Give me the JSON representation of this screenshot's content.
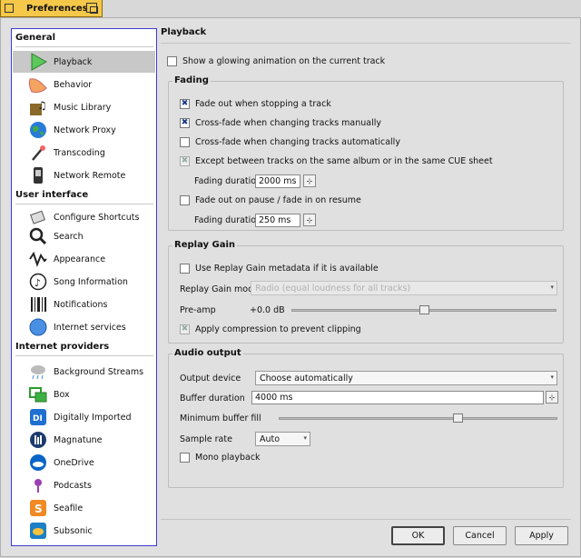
{
  "window": {
    "title": "Preferences"
  },
  "sidebar": {
    "sections": [
      {
        "heading": "General",
        "items": [
          {
            "label": "Playback",
            "icon": "play-icon"
          },
          {
            "label": "Behavior",
            "icon": "behavior-icon"
          },
          {
            "label": "Music Library",
            "icon": "music-library-icon"
          },
          {
            "label": "Network Proxy",
            "icon": "globe-icon"
          },
          {
            "label": "Transcoding",
            "icon": "magic-wand-icon"
          },
          {
            "label": "Network Remote",
            "icon": "remote-icon"
          }
        ]
      },
      {
        "heading": "User interface",
        "items": [
          {
            "label": "Configure Shortcuts",
            "icon": "shortcuts-icon"
          },
          {
            "label": "Search",
            "icon": "search-icon"
          },
          {
            "label": "Appearance",
            "icon": "appearance-icon"
          },
          {
            "label": "Song Information",
            "icon": "song-info-icon"
          },
          {
            "label": "Notifications",
            "icon": "notifications-icon"
          },
          {
            "label": "Internet services",
            "icon": "internet-icon"
          }
        ]
      },
      {
        "heading": "Internet providers",
        "items": [
          {
            "label": "Background Streams",
            "icon": "cloud-rain-icon"
          },
          {
            "label": "Box",
            "icon": "box-icon"
          },
          {
            "label": "Digitally Imported",
            "icon": "di-icon"
          },
          {
            "label": "Magnatune",
            "icon": "magnatune-icon"
          },
          {
            "label": "OneDrive",
            "icon": "onedrive-icon"
          },
          {
            "label": "Podcasts",
            "icon": "podcast-icon"
          },
          {
            "label": "Seafile",
            "icon": "seafile-icon"
          },
          {
            "label": "Subsonic",
            "icon": "subsonic-icon"
          }
        ]
      }
    ]
  },
  "playback": {
    "title": "Playback",
    "glow_label": "Show a glowing animation on the current track",
    "fading": {
      "title": "Fading",
      "fade_stop": "Fade out when stopping a track",
      "crossfade_manual": "Cross-fade when changing tracks manually",
      "crossfade_auto": "Cross-fade when changing tracks automatically",
      "except_album": "Except between tracks on the same album or in the same CUE sheet",
      "fading_duration_label": "Fading duration",
      "fading_duration_value": "2000 ms",
      "fade_pause": "Fade out on pause / fade in on resume",
      "fading_duration2_label": "Fading duration",
      "fading_duration2_value": "250 ms"
    },
    "replay_gain": {
      "title": "Replay Gain",
      "use_label": "Use Replay Gain metadata if it is available",
      "mode_label": "Replay Gain mode",
      "mode_value": "Radio (equal loudness for all tracks)",
      "preamp_label": "Pre-amp",
      "preamp_value": "+0.0 dB",
      "preamp_level": 0.5,
      "compress_label": "Apply compression to prevent clipping"
    },
    "audio_output": {
      "title": "Audio output",
      "device_label": "Output device",
      "device_value": "Choose automatically",
      "buffer_label": "Buffer duration",
      "buffer_value": "4000 ms",
      "min_fill_label": "Minimum buffer fill",
      "min_fill_level": 0.64,
      "sample_label": "Sample rate",
      "sample_value": "Auto",
      "mono_label": "Mono playback"
    }
  },
  "buttons": {
    "ok": "OK",
    "cancel": "Cancel",
    "apply": "Apply"
  }
}
